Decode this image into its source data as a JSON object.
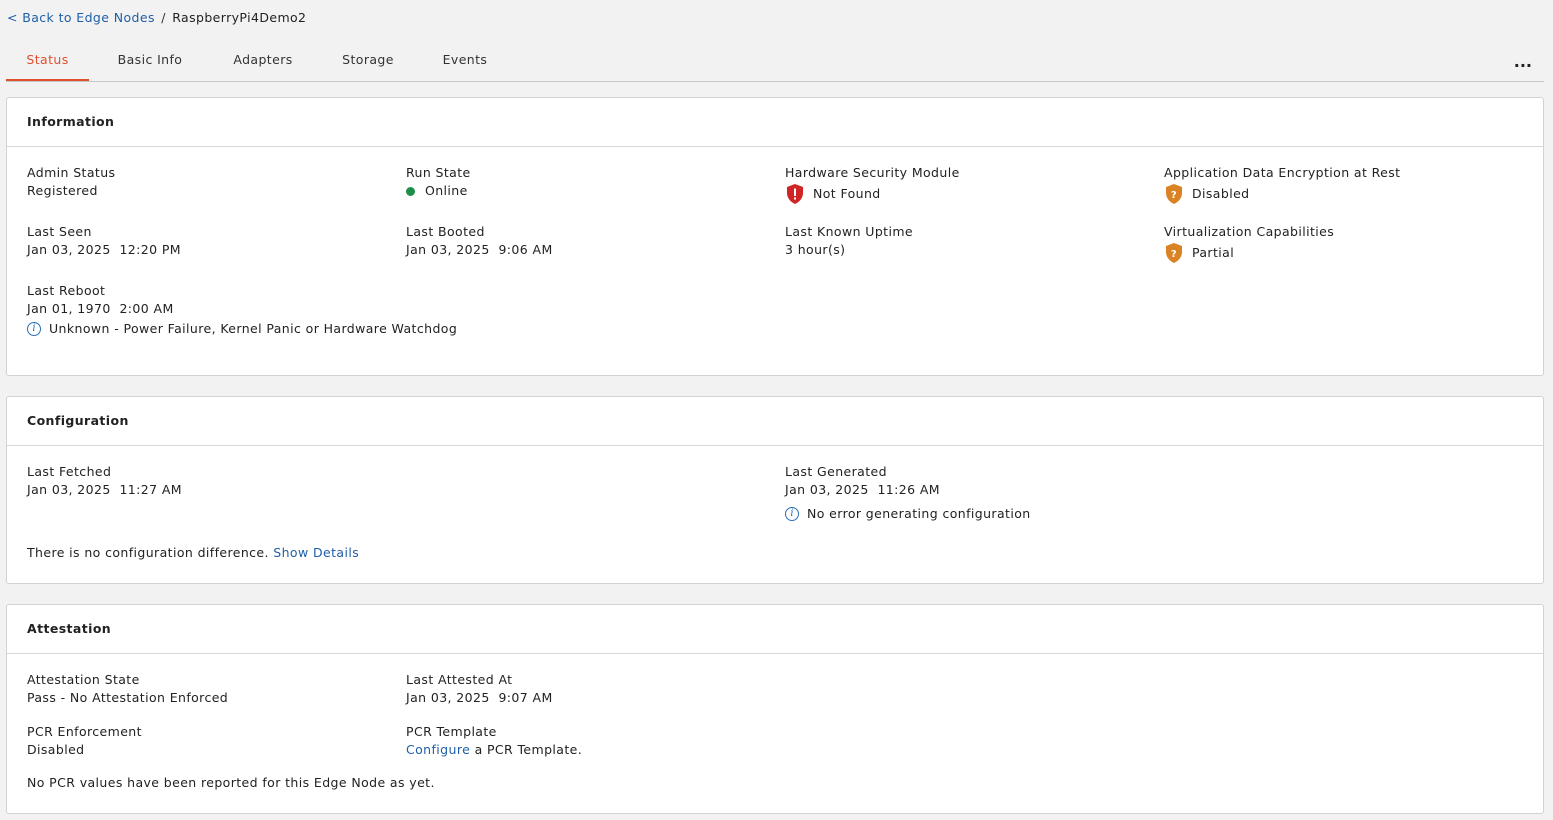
{
  "breadcrumb": {
    "back_label": "< Back to Edge Nodes",
    "separator": "/",
    "current": "RaspberryPi4Demo2"
  },
  "tabs": [
    {
      "label": "Status",
      "active": true
    },
    {
      "label": "Basic Info"
    },
    {
      "label": "Adapters"
    },
    {
      "label": "Storage"
    },
    {
      "label": "Events"
    }
  ],
  "more_label": "...",
  "information": {
    "title": "Information",
    "admin_status": {
      "label": "Admin Status",
      "value": "Registered"
    },
    "run_state": {
      "label": "Run State",
      "value": "Online",
      "color": "#1e8c4b"
    },
    "hsm": {
      "label": "Hardware Security Module",
      "value": "Not Found",
      "icon": "alert-shield-icon",
      "color": "#d02525"
    },
    "encryption": {
      "label": "Application Data Encryption at Rest",
      "value": "Disabled",
      "icon": "question-shield-icon",
      "color": "#d98324"
    },
    "last_seen": {
      "label": "Last Seen",
      "value": "Jan 03, 2025  12:20 PM"
    },
    "last_booted": {
      "label": "Last Booted",
      "value": "Jan 03, 2025  9:06 AM"
    },
    "uptime": {
      "label": "Last Known Uptime",
      "value": "3 hour(s)"
    },
    "virtualization": {
      "label": "Virtualization Capabilities",
      "value": "Partial",
      "icon": "question-shield-icon",
      "color": "#d98324"
    },
    "last_reboot": {
      "label": "Last Reboot",
      "value": "Jan 01, 1970  2:00 AM",
      "reason": "Unknown - Power Failure, Kernel Panic or Hardware Watchdog"
    }
  },
  "configuration": {
    "title": "Configuration",
    "last_fetched": {
      "label": "Last Fetched",
      "value": "Jan 03, 2025  11:27 AM"
    },
    "last_generated": {
      "label": "Last Generated",
      "value": "Jan 03, 2025  11:26 AM",
      "note": "No error generating configuration"
    },
    "diff_text": "There is no configuration difference.",
    "show_details": "Show Details"
  },
  "attestation": {
    "title": "Attestation",
    "state": {
      "label": "Attestation State",
      "value": "Pass - No Attestation Enforced"
    },
    "last_attested": {
      "label": "Last Attested At",
      "value": "Jan 03, 2025  9:07 AM"
    },
    "pcr_enforcement": {
      "label": "PCR Enforcement",
      "value": "Disabled"
    },
    "pcr_template": {
      "label": "PCR Template",
      "configure_link": "Configure",
      "suffix": "a PCR Template."
    },
    "footer": "No PCR values have been reported for this Edge Node as yet."
  }
}
